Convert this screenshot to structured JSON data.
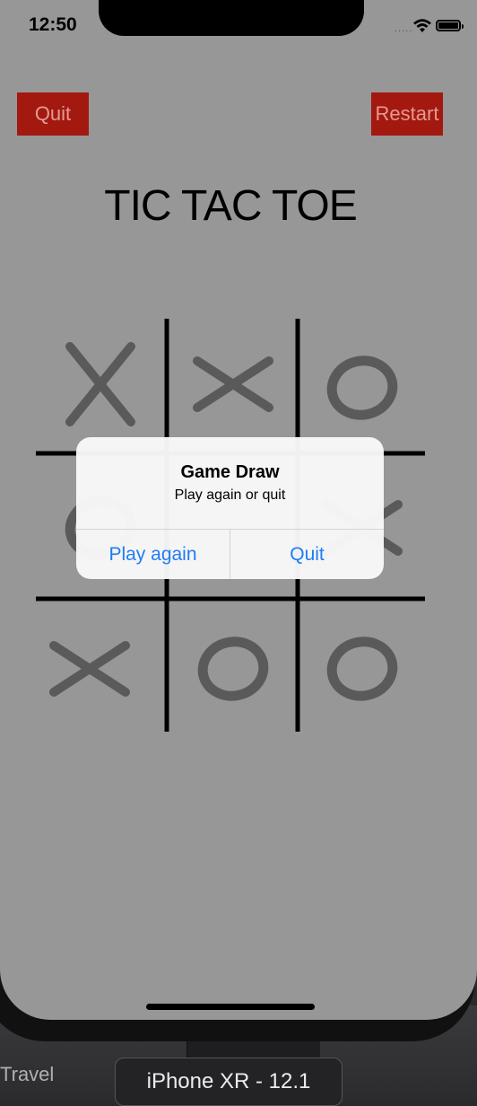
{
  "status_bar": {
    "time": "12:50",
    "signal": "....."
  },
  "header": {
    "quit_label": "Quit",
    "restart_label": "Restart",
    "title": "TIC TAC TOE"
  },
  "board": {
    "cells": [
      "X",
      "X",
      "O",
      "O",
      "",
      "X",
      "X",
      "O",
      "O"
    ]
  },
  "alert": {
    "title": "Game Draw",
    "message": "Play again or quit",
    "primary_label": "Play again",
    "secondary_label": "Quit"
  },
  "simulator": {
    "device_label": "iPhone XR - 12.1",
    "side_label": "Travel"
  },
  "colors": {
    "button_red": "#a3190f",
    "screen_gray": "#979797",
    "alert_blue": "#1f7cf5",
    "mark_gray": "#5a5a5a"
  }
}
